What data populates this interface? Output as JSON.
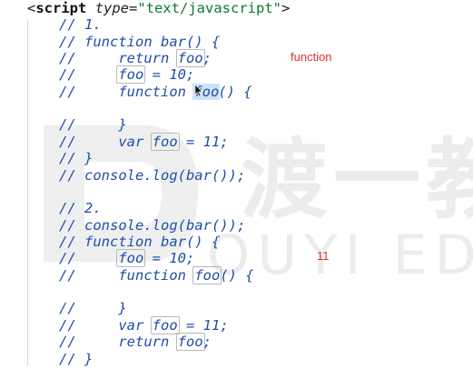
{
  "watermark": {
    "cn": "渡一教",
    "en": "OUYI EDUC"
  },
  "code": {
    "header": {
      "open": "<",
      "tag": "script",
      "attr": "type",
      "eq": "=",
      "value": "\"text/javascript\"",
      "close": ">"
    },
    "block1": {
      "l1": "// 1.",
      "l2": "// function bar() {",
      "l3_pre": "//     return ",
      "l3_box": "foo",
      "l3_post": ";",
      "l4_pre": "//     ",
      "l4_box": "foo",
      "l4_post": " = 10;",
      "l5_pre": "//     function ",
      "l5_box": "foo",
      "l5_post": "() {",
      "l6": "//     }",
      "l7_pre": "//     var ",
      "l7_box": "foo",
      "l7_post": " = 11;",
      "l8": "// }",
      "l9": "// console.log(bar());"
    },
    "block2": {
      "l1": "// 2.",
      "l2": "// console.log(bar());",
      "l3": "// function bar() {",
      "l4_pre": "//     ",
      "l4_box": "foo",
      "l4_post": " = 10;",
      "l5_pre": "//     function ",
      "l5_box": "foo",
      "l5_post": "() {",
      "l6": "//     }",
      "l7_pre": "//     var ",
      "l7_box": "foo",
      "l7_post": " = 11;",
      "l8_pre": "//     return ",
      "l8_box": "foo",
      "l8_post": ";",
      "l9": "// }"
    }
  },
  "annotations": {
    "note1": "function",
    "note2": "11"
  },
  "colors": {
    "comment": "#1f4fa8",
    "string": "#0a7a32",
    "annotation": "#e0312a",
    "highlight": "#cfe2f7"
  },
  "icons": {
    "watermark_logo": "duyi-logo-icon",
    "cursor": "mouse-pointer-icon"
  }
}
